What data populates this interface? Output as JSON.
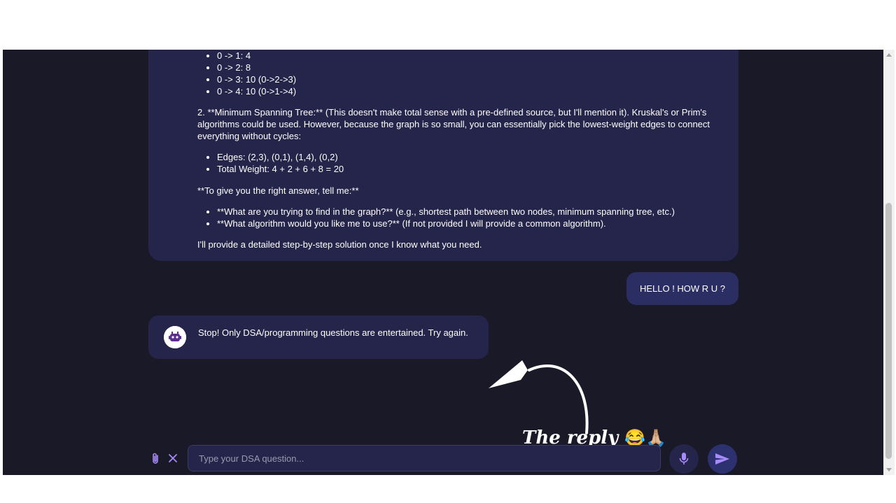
{
  "conversation": {
    "bot_message_1": {
      "paths": [
        "0 -> 1: 4",
        "0 -> 2: 8",
        "0 -> 3: 10 (0->2->3)",
        "0 -> 4: 10 (0->1->4)"
      ],
      "mst_heading": "2. **Minimum Spanning Tree:** (This doesn't make total sense with a pre-defined source, but I'll mention it). Kruskal's or Prim's algorithms could be used. However, because the graph is so small, you can essentially pick the lowest-weight edges to connect everything without cycles:",
      "mst_items": [
        "Edges: (2,3), (0,1), (1,4), (0,2)",
        "Total Weight: 4 + 2 + 6 + 8 = 20"
      ],
      "ask_heading": "**To give you the right answer, tell me:**",
      "ask_items": [
        "**What are you trying to find in the graph?** (e.g., shortest path between two nodes, minimum spanning tree, etc.)",
        "**What algorithm would you like me to use?** (If not provided I will provide a common algorithm)."
      ],
      "closing": "I'll provide a detailed step-by-step solution once I know what you need."
    },
    "user_message": "HELLO ! HOW R U ?",
    "bot_message_2": "Stop! Only DSA/programming questions are entertained. Try again."
  },
  "composer": {
    "placeholder": "Type your DSA question...",
    "attach_icon": "paperclip-icon",
    "clear_icon": "close-icon",
    "mic_icon": "microphone-icon",
    "send_icon": "send-icon"
  },
  "annotation": {
    "text": "The reply",
    "emoji": "😂🙏🏼"
  },
  "colors": {
    "app_background": "#1a1928",
    "bot_bubble": "#25244a",
    "user_bubble": "#2b2e63",
    "accent": "#a78bfa"
  }
}
